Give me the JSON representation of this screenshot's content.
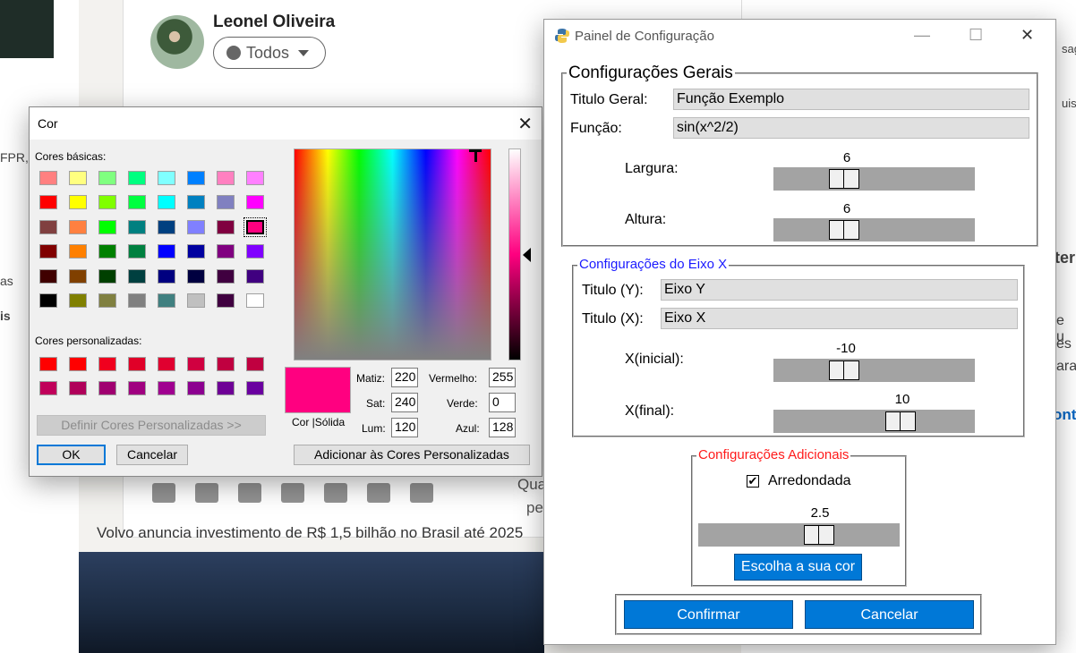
{
  "background": {
    "author_name": "Leonel Oliveira",
    "audience_label": "Todos",
    "partial_text_1": "Qua",
    "partial_text_2": "pe",
    "headline": "Volvo anuncia investimento de R$ 1,5 bilhão no Brasil até 2025",
    "left_fragment_1": "FPR,",
    "left_fragment_2": "as",
    "left_fragment_3": "is",
    "right_fragment_1": "sag",
    "right_fragment_2": "uisa",
    "right_fragment_3": "ter",
    "right_fragment_4": "e u",
    "right_fragment_5": "es",
    "right_fragment_6": "ara",
    "right_fragment_7": "ont"
  },
  "color_dialog": {
    "title": "Cor",
    "close_glyph": "✕",
    "basic_colors_label": "Cores básicas:",
    "basic_colors": [
      [
        "#ff8080",
        "#ffff80",
        "#80ff80",
        "#00ff80",
        "#80ffff",
        "#0080ff",
        "#ff80c0",
        "#ff80ff"
      ],
      [
        "#ff0000",
        "#ffff00",
        "#80ff00",
        "#00ff40",
        "#00ffff",
        "#0080c0",
        "#8080c0",
        "#ff00ff"
      ],
      [
        "#804040",
        "#ff8040",
        "#00ff00",
        "#008080",
        "#004080",
        "#8080ff",
        "#800040",
        "#ff0080"
      ],
      [
        "#800000",
        "#ff8000",
        "#008000",
        "#008040",
        "#0000ff",
        "#0000a0",
        "#800080",
        "#8000ff"
      ],
      [
        "#400000",
        "#804000",
        "#004000",
        "#004040",
        "#000080",
        "#000040",
        "#400040",
        "#400080"
      ],
      [
        "#000000",
        "#808000",
        "#808040",
        "#808080",
        "#408080",
        "#c0c0c0",
        "#400040",
        "#ffffff"
      ]
    ],
    "selected_basic": "2-7",
    "custom_colors_label": "Cores personalizadas:",
    "custom_colors": [
      [
        "#ff0000",
        "#ff0000",
        "#f0001e",
        "#e00028",
        "#e00030",
        "#d00040",
        "#c00040",
        "#c00040"
      ],
      [
        "#c0005a",
        "#b0005a",
        "#a00070",
        "#a00080",
        "#a00090",
        "#8c0090",
        "#6e0096",
        "#6a00a0"
      ]
    ],
    "define_custom_label": "Definir Cores Personalizadas >>",
    "ok_label": "OK",
    "cancel_label": "Cancelar",
    "color_solid_label": "Cor  |Sólida",
    "hue_label": "Matiz:",
    "hue_value": "220",
    "sat_label": "Sat:",
    "sat_value": "240",
    "lum_label": "Lum:",
    "lum_value": "120",
    "red_label": "Vermelho:",
    "red_value": "255",
    "green_label": "Verde:",
    "green_value": "0",
    "blue_label": "Azul:",
    "blue_value": "128",
    "add_custom_label": "Adicionar às Cores Personalizadas",
    "current_color": "#ff0080"
  },
  "config_window": {
    "title": "Painel de Configuração",
    "minimize_glyph": "—",
    "maximize_glyph": "☐",
    "close_glyph": "✕",
    "general": {
      "group_title": "Configurações Gerais",
      "title_label": "Titulo Geral:",
      "title_value": "Função Exemplo",
      "function_label": "Função:",
      "function_value": "sin(x^2/2)",
      "width_label": "Largura:",
      "width_value": "6",
      "height_label": "Altura:",
      "height_value": "6"
    },
    "xaxis": {
      "group_title": "Configurações do Eixo X",
      "title_color": "#1a1aff",
      "y_title_label": "Titulo (Y):",
      "y_title_value": "Eixo Y",
      "x_title_label": "Titulo (X):",
      "x_title_value": "Eixo X",
      "x_start_label": "X(inicial):",
      "x_start_value": "-10",
      "x_end_label": "X(final):",
      "x_end_value": "10"
    },
    "additional": {
      "group_title": "Configurações Adicionais",
      "title_color": "#ff1a1a",
      "rounded_label": "Arredondada",
      "rounded_checked": "✔",
      "rounding_value": "2.5",
      "choose_color_label": "Escolha a sua cor"
    },
    "confirm_label": "Confirmar",
    "cancel_label": "Cancelar",
    "accent_color": "#0078d7"
  }
}
